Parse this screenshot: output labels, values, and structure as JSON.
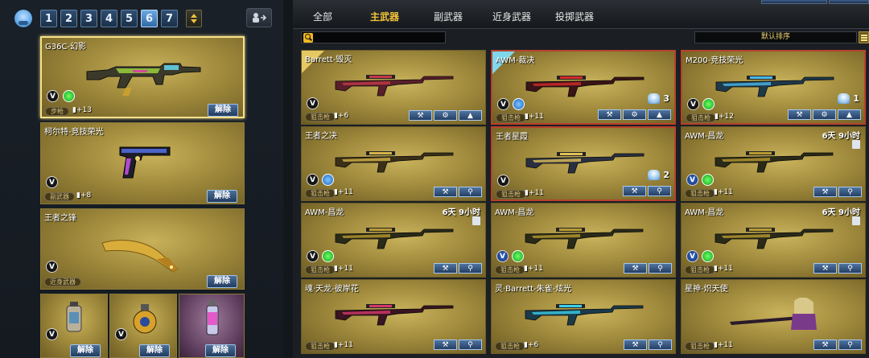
{
  "left": {
    "preset_numbers": [
      "1",
      "2",
      "3",
      "4",
      "5",
      "6",
      "7"
    ],
    "active_preset": "6",
    "cards": [
      {
        "title": "G36C-幻影",
        "type": "步枪",
        "bullet": "+13",
        "button": "解除"
      },
      {
        "title": "柯尔特-竞技荣光",
        "type": "副武器",
        "bullet": "+8",
        "button": "解除"
      },
      {
        "title": "王者之锋",
        "type": "近身武器",
        "bullet": "",
        "button": "解除"
      }
    ],
    "grenades": [
      {
        "button": "解除"
      },
      {
        "button": "解除"
      },
      {
        "button": "解除"
      }
    ]
  },
  "right": {
    "tabs": [
      "全部",
      "主武器",
      "副武器",
      "近身武器",
      "投掷武器"
    ],
    "active_tab": "主武器",
    "sort_label": "默认排序",
    "weapons": [
      {
        "title": "Barrett-毁灭",
        "type": "狙击枪",
        "bullet": "+6",
        "timer": "",
        "count": ""
      },
      {
        "title": "AWM-裁决",
        "type": "狙击枪",
        "bullet": "+11",
        "timer": "",
        "count": "3"
      },
      {
        "title": "M200-竞技荣光",
        "type": "狙击枪",
        "bullet": "+12",
        "timer": "",
        "count": "1"
      },
      {
        "title": "王者之决",
        "type": "狙击枪",
        "bullet": "+11",
        "timer": "",
        "count": ""
      },
      {
        "title": "王者星霞",
        "type": "狙击枪",
        "bullet": "+11",
        "timer": "",
        "count": "2"
      },
      {
        "title": "AWM-昌龙",
        "type": "狙击枪",
        "bullet": "+11",
        "timer": "6天 9小时",
        "count": ""
      },
      {
        "title": "AWM-昌龙",
        "type": "狙击枪",
        "bullet": "+11",
        "timer": "6天 9小时",
        "count": ""
      },
      {
        "title": "AWM-昌龙",
        "type": "狙击枪",
        "bullet": "+11",
        "timer": "",
        "count": ""
      },
      {
        "title": "AWM-昌龙",
        "type": "狙击枪",
        "bullet": "+11",
        "timer": "6天 9小时",
        "count": ""
      },
      {
        "title": "魂·天龙-彼岸花",
        "type": "狙击枪",
        "bullet": "+11",
        "timer": "",
        "count": ""
      },
      {
        "title": "灵·Barrett-朱雀-炫光",
        "type": "狙击枪",
        "bullet": "+6",
        "timer": "",
        "count": ""
      },
      {
        "title": "星神-炽天使",
        "type": "狙击枪",
        "bullet": "+11",
        "timer": "",
        "count": ""
      }
    ]
  }
}
